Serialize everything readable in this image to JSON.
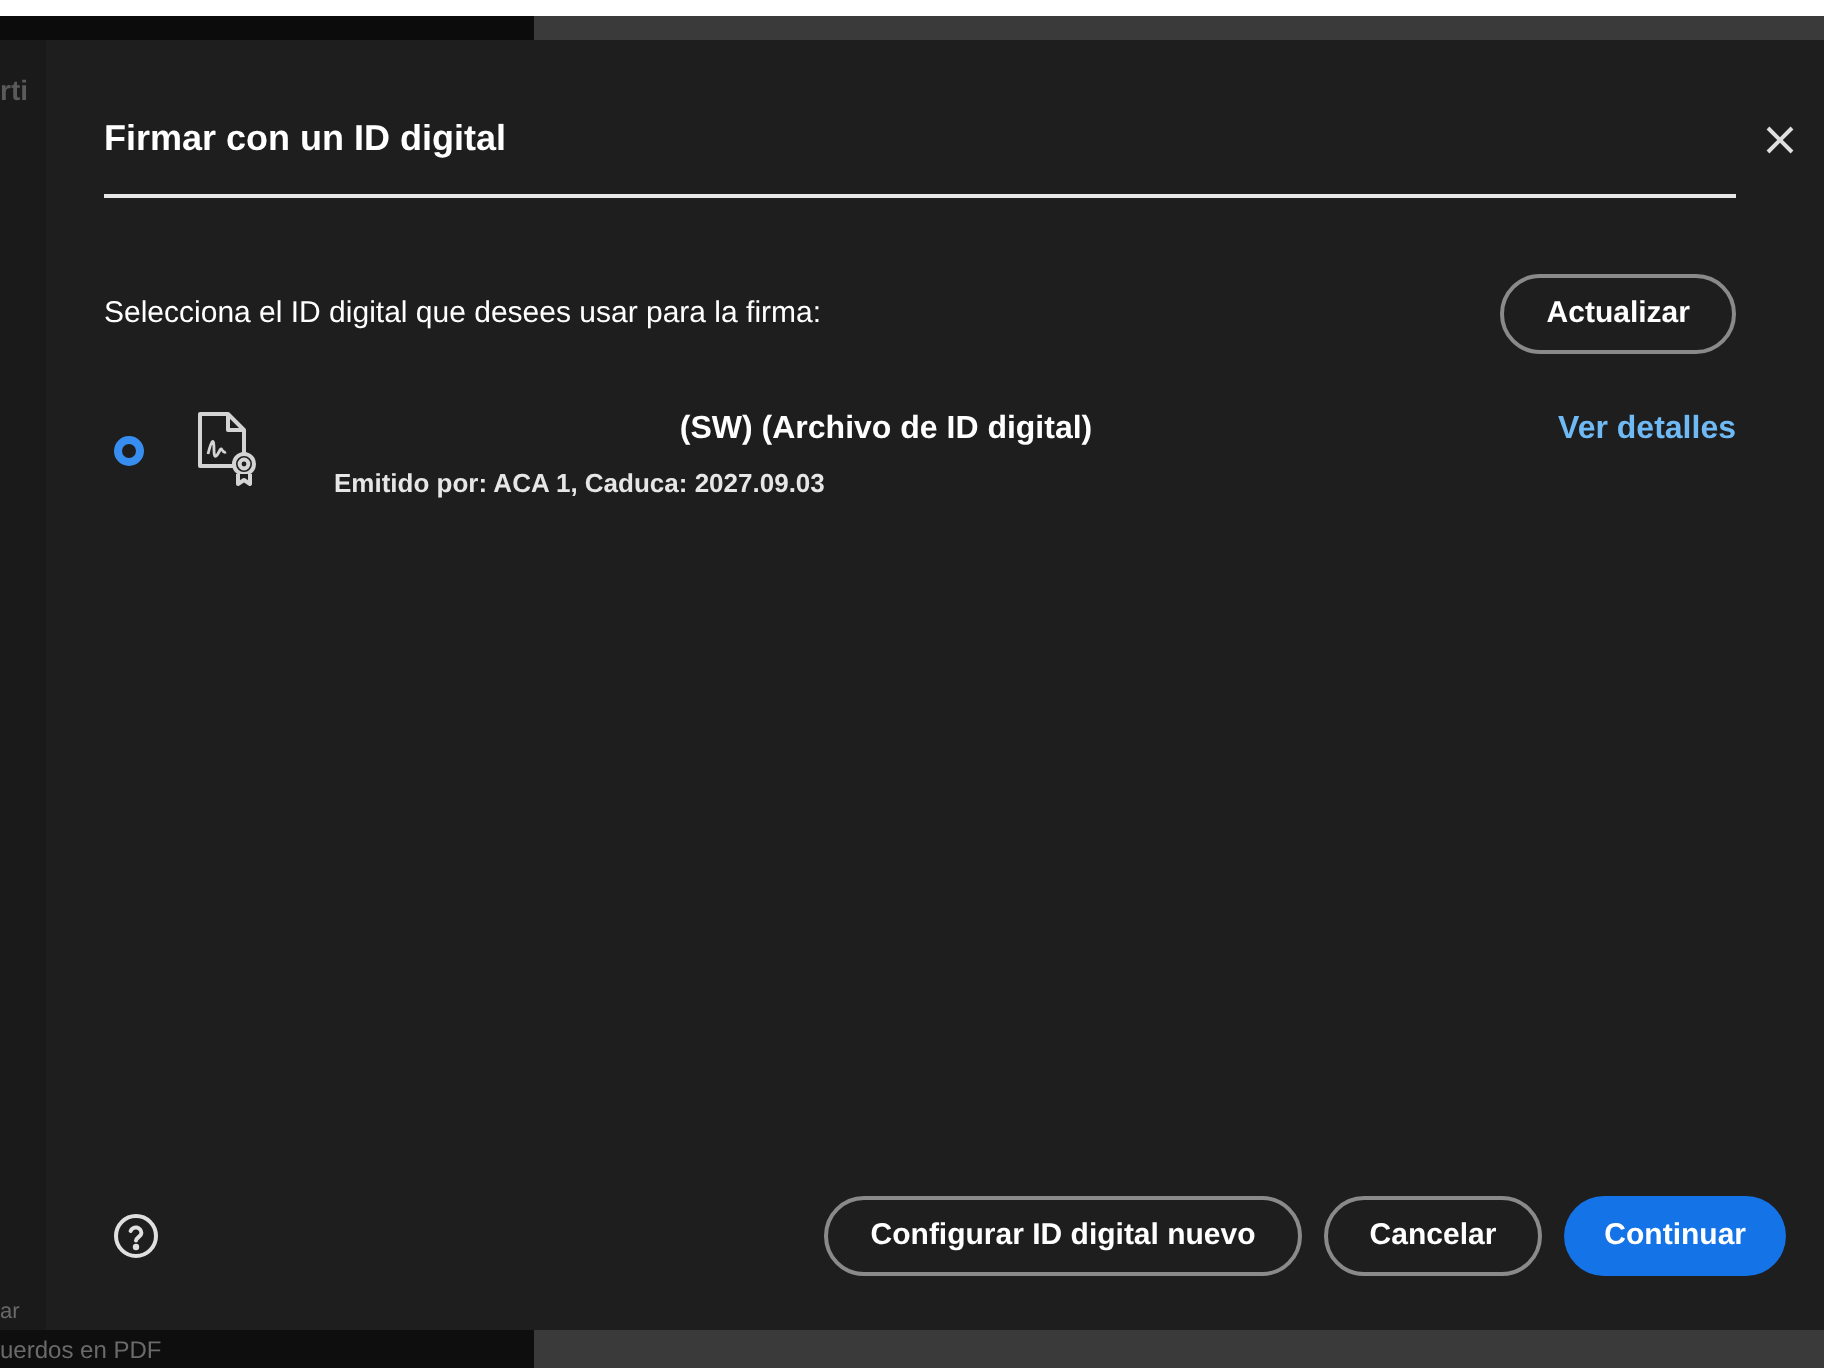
{
  "background": {
    "texts": [
      "rti",
      "ar",
      "uerdos en PDF"
    ]
  },
  "dialog": {
    "title": "Firmar con un ID digital",
    "prompt": "Selecciona el ID digital que desees usar para la firma:",
    "refresh_button": "Actualizar",
    "ids": [
      {
        "name": "(SW) (Archivo de ID digital)",
        "issuer": "Emitido por: ACA 1, Caduca: 2027.09.03",
        "details_link": "Ver detalles",
        "selected": true
      }
    ],
    "buttons": [
      {
        "label": "Configurar ID digital nuevo",
        "kind": "secondary"
      },
      {
        "label": "Cancelar",
        "kind": "secondary"
      },
      {
        "label": "Continuar",
        "kind": "primary"
      }
    ]
  }
}
